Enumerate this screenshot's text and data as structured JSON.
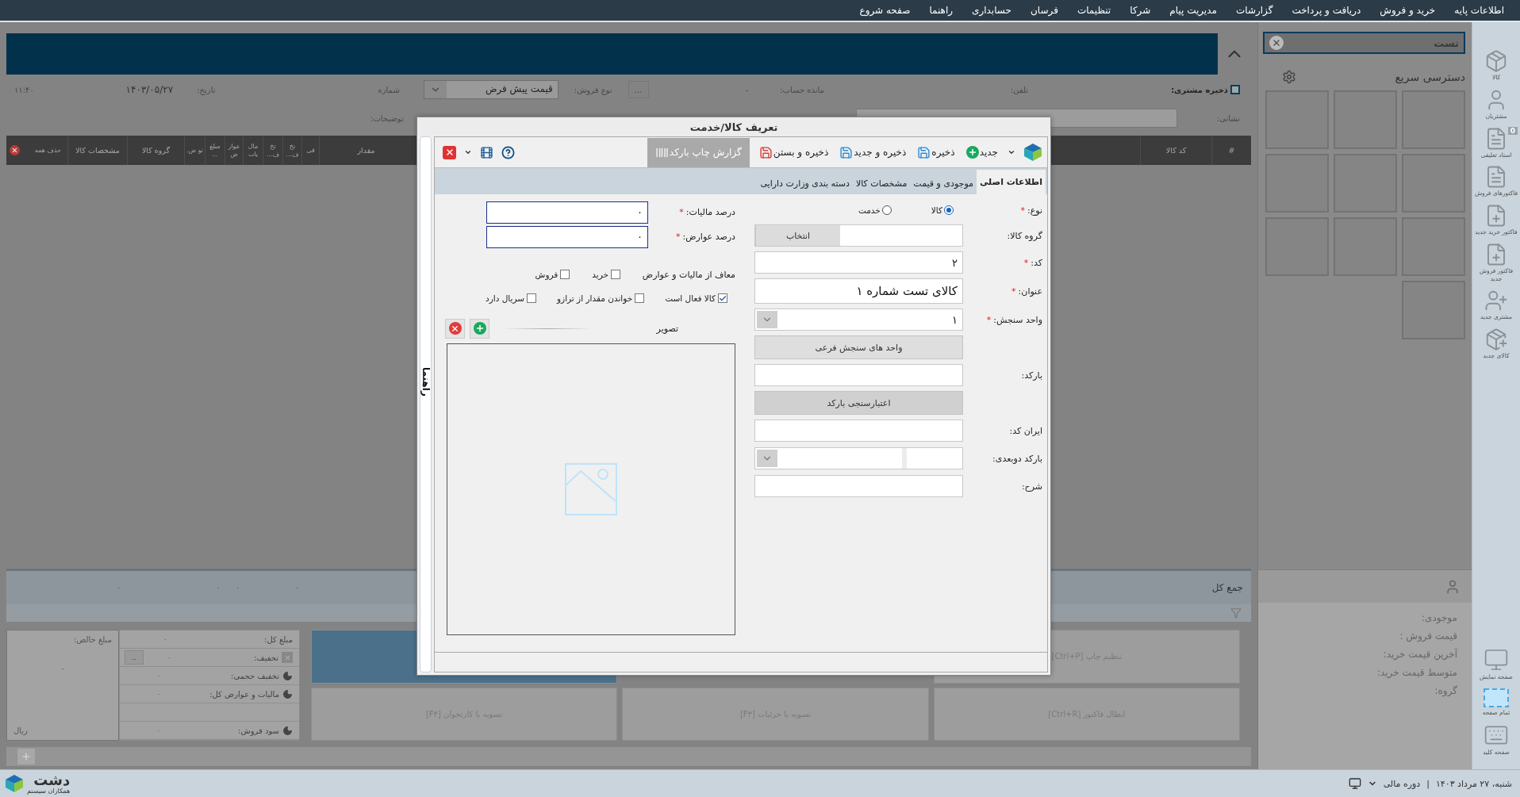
{
  "menu_bar": {
    "items": [
      "اطلاعات پایه",
      "خرید و فروش",
      "دریافت و پرداخت",
      "گزارشات",
      "مدیریت پیام",
      "شرکا",
      "تنظیمات",
      "فرسان",
      "حسابداری",
      "راهنما",
      "صفحه شروع"
    ]
  },
  "invoice": {
    "customer_save": {
      "label": "ذخیره مشتری:",
      "checked": false
    },
    "phone_label": "تلفن:",
    "balance_label": "مانده حساب:",
    "balance_value": "-",
    "more_button": "...",
    "sale_type_label": "نوع فروش:",
    "sale_type_value": "قیمت پیش فرض",
    "number_label": "شماره",
    "date_label": "تاریخ:",
    "date_value": "۱۴۰۳/۰۵/۲۷",
    "time": "۱۱:۴۰",
    "address_label": "نشانی:",
    "notes_label": "توضیحات:",
    "columns_right": [
      "#",
      "کد کالا"
    ],
    "columns_left": [
      "مقدار",
      "فی",
      "تخ ف...",
      "تخ ف...",
      "مال یات",
      "عوار ض",
      "مبلغ ...",
      "تو ض.",
      "گروه کالا",
      "مشخصات کالا"
    ],
    "delete_all": "حذف همه",
    "total_title": "جمع کل",
    "totals": [
      "۰",
      "۰",
      "۰",
      "۰"
    ],
    "summary": {
      "net_label": "مبلغ خالص:",
      "net_value": "۰",
      "currency": "ریال",
      "rows": [
        {
          "kind": "plain",
          "label": "مبلغ کل:",
          "value": "۰"
        },
        {
          "kind": "discount",
          "label": "تخفیف:",
          "value": "۰",
          "button": ".."
        },
        {
          "kind": "toggle",
          "label": "تخفیف حجمی:",
          "value": "۰"
        },
        {
          "kind": "toggle",
          "label": "مالیات و عوارض کل:",
          "value": "۰"
        },
        {
          "kind": "spacer"
        },
        {
          "kind": "toggle",
          "label": "سود فروش:",
          "value": "۰"
        }
      ]
    },
    "actions_top": [
      {
        "kind": "plain",
        "label": "تنظیم چاپ [Ctrl+P]"
      },
      {
        "kind": "accent"
      }
    ],
    "actions_bottom": [
      {
        "label": "ابطال فاکتور [Ctrl+R]"
      },
      {
        "label": "تسویه با جزئیات [F۳]"
      },
      {
        "label": "تسویه با کارتخوان [F۴]"
      }
    ]
  },
  "side_panel": {
    "search_value": "تست",
    "quick_title": "دسترسی سریع",
    "info_labels": [
      "موجودی:",
      "قیمت فروش :",
      "آخرین قیمت خرید:",
      "متوسط قیمت خرید:",
      "گروه:"
    ]
  },
  "icon_strip": {
    "top": [
      {
        "kind": "box",
        "label": "کالا"
      },
      {
        "kind": "person",
        "label": "مشتریان"
      },
      {
        "kind": "document",
        "label": "اسناد تعلیقی",
        "badge": "0"
      },
      {
        "kind": "document",
        "label": "فاکتورهای فروش"
      },
      {
        "kind": "document-add",
        "label": "فاکتور خرید جدید"
      },
      {
        "kind": "document-add",
        "label": "فاکتور فروش جدید"
      },
      {
        "kind": "person-add",
        "label": "مشتری جدید"
      },
      {
        "kind": "box-add",
        "label": "کالای جدید"
      }
    ],
    "bottom": [
      {
        "kind": "monitor",
        "label": "صفحه نمایش"
      },
      {
        "kind": "fullscreen",
        "label": "تمام صفحه"
      },
      {
        "kind": "keyboard",
        "label": "صفحه کلید"
      }
    ]
  },
  "status_bar": {
    "date": "شنبه، ۲۷ مرداد ۱۴۰۳",
    "separator": "|",
    "period": "دوره مالی",
    "logo_title": "دشت",
    "logo_subtitle": "همکاران سیستم"
  },
  "dialog": {
    "title": "تعریف کالا/خدمت",
    "side_tab": "راهنما",
    "toolbar": [
      {
        "kind": "new",
        "label": "جدید",
        "disabled": false
      },
      {
        "kind": "save",
        "label": "ذخیره",
        "disabled": false
      },
      {
        "kind": "save-new",
        "label": "ذخیره و جدید",
        "disabled": false
      },
      {
        "kind": "save-close",
        "label": "ذخیره و بستن",
        "disabled": false
      },
      {
        "kind": "barcode",
        "label": "گزارش چاپ بارکد",
        "disabled": true
      }
    ],
    "tabs": [
      {
        "label": "اطلاعات اصلی",
        "selected": true
      },
      {
        "label": "موجودی و قیمت",
        "selected": false
      },
      {
        "label": "مشخصات کالا",
        "selected": false
      },
      {
        "label": "دسته بندی وزارت دارایی",
        "selected": false
      }
    ],
    "main_fields": [
      {
        "kind": "radio",
        "label": "نوع:",
        "required_mark": "*",
        "options": [
          {
            "label": "کالا",
            "selected": true
          },
          {
            "label": "خدمت",
            "selected": false
          }
        ]
      },
      {
        "kind": "picker",
        "label": "گروه کالا:",
        "button": "انتخاب"
      },
      {
        "kind": "text",
        "label": "کد:",
        "required_mark": "*",
        "value": "۲"
      },
      {
        "kind": "title",
        "label": "عنوان:",
        "required_mark": "*",
        "value": "کالای تست شماره ۱"
      },
      {
        "kind": "select",
        "label": "واحد سنجش:",
        "required_mark": "*",
        "value": "۱"
      },
      {
        "kind": "button",
        "label": "واحد های سنجش فرعی"
      },
      {
        "kind": "text",
        "label": "بارکد:"
      },
      {
        "kind": "button",
        "label": "اعتبارسنجی بارکد"
      },
      {
        "kind": "text",
        "label": "ایران کد:"
      },
      {
        "kind": "split-select",
        "label": "بارکد دوبعدی:"
      },
      {
        "kind": "text",
        "label": "شرح:"
      }
    ],
    "tax_fields": [
      {
        "label": "درصد مالیات:",
        "required_mark": "*",
        "value": "۰"
      },
      {
        "label": "درصد عوارض:",
        "required_mark": "*",
        "value": "۰"
      }
    ],
    "exempt": {
      "label": "معاف از مالیات و عوارض",
      "options": [
        {
          "label": "خرید",
          "checked": false
        },
        {
          "label": "فروش",
          "checked": false
        }
      ]
    },
    "flags": [
      {
        "label": "کالا فعال است",
        "checked": true
      },
      {
        "label": "خواندن مقدار از ترازو",
        "checked": false
      },
      {
        "label": "سریال دارد",
        "checked": false
      }
    ],
    "image_label": "تصویر"
  }
}
